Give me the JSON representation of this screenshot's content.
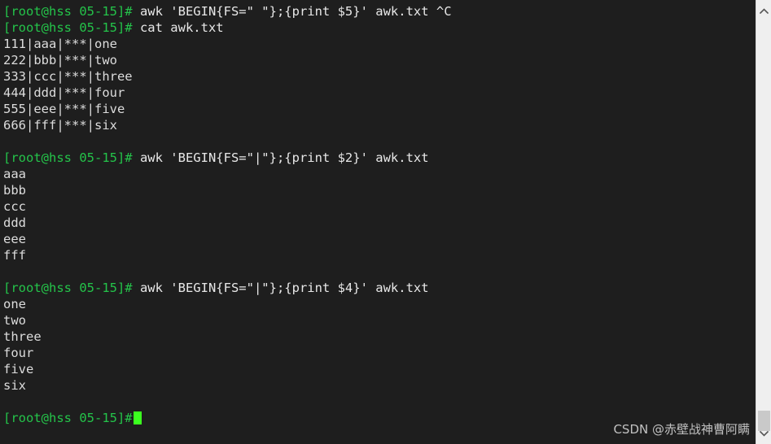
{
  "terminal": {
    "background_color": "#1e1e1e",
    "prompt_color": "#24c44a",
    "text_color": "#d6d6d6",
    "cursor_color": "#3bff1f",
    "prompt": "[root@hss 05-15]#",
    "lines": [
      {
        "type": "command",
        "prompt": "[root@hss 05-15]#",
        "text": " awk 'BEGIN{FS=\" \"};{print $5}' awk.txt ^C"
      },
      {
        "type": "command",
        "prompt": "[root@hss 05-15]#",
        "text": " cat awk.txt"
      },
      {
        "type": "output",
        "text": "111|aaa|***|one"
      },
      {
        "type": "output",
        "text": "222|bbb|***|two"
      },
      {
        "type": "output",
        "text": "333|ccc|***|three"
      },
      {
        "type": "output",
        "text": "444|ddd|***|four"
      },
      {
        "type": "output",
        "text": "555|eee|***|five"
      },
      {
        "type": "output",
        "text": "666|fff|***|six"
      },
      {
        "type": "blank",
        "text": " "
      },
      {
        "type": "command",
        "prompt": "[root@hss 05-15]#",
        "text": " awk 'BEGIN{FS=\"|\"};{print $2}' awk.txt"
      },
      {
        "type": "output",
        "text": "aaa"
      },
      {
        "type": "output",
        "text": "bbb"
      },
      {
        "type": "output",
        "text": "ccc"
      },
      {
        "type": "output",
        "text": "ddd"
      },
      {
        "type": "output",
        "text": "eee"
      },
      {
        "type": "output",
        "text": "fff"
      },
      {
        "type": "blank",
        "text": " "
      },
      {
        "type": "command",
        "prompt": "[root@hss 05-15]#",
        "text": " awk 'BEGIN{FS=\"|\"};{print $4}' awk.txt"
      },
      {
        "type": "output",
        "text": "one"
      },
      {
        "type": "output",
        "text": "two"
      },
      {
        "type": "output",
        "text": "three"
      },
      {
        "type": "output",
        "text": "four"
      },
      {
        "type": "output",
        "text": "five"
      },
      {
        "type": "output",
        "text": "six"
      },
      {
        "type": "blank",
        "text": " "
      },
      {
        "type": "prompt-cursor",
        "prompt": "[root@hss 05-15]#",
        "text": ""
      }
    ]
  },
  "scrollbar": {
    "up_arrow_icon": "chevron-up-icon",
    "down_arrow_icon": "chevron-down-icon",
    "track_color": "#efefef",
    "thumb_color": "#c9c9c9"
  },
  "watermark": {
    "text": "CSDN @赤壁战神曹阿瞒"
  }
}
